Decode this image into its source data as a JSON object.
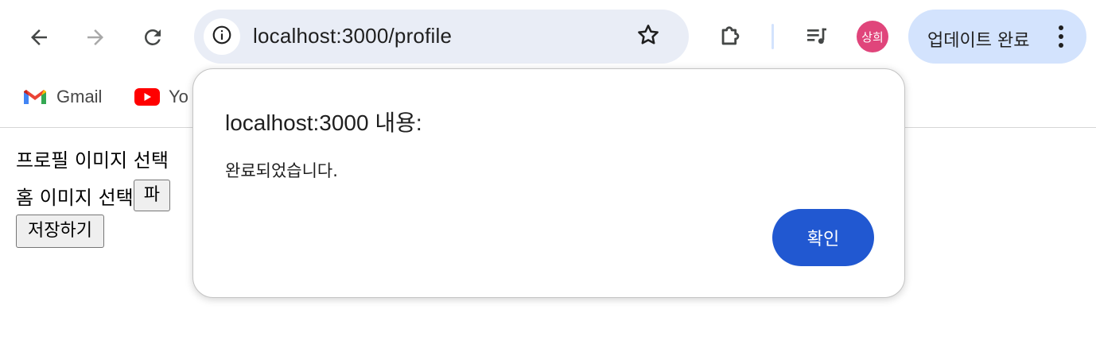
{
  "browser": {
    "url": "localhost:3000/profile",
    "profile_initials": "상희",
    "update_label": "업데이트 완료",
    "icons": {
      "back": "back-arrow-icon",
      "forward": "forward-arrow-icon",
      "reload": "reload-icon",
      "site_info": "info-icon",
      "bookmark_star": "star-icon",
      "extensions": "puzzle-icon",
      "media": "media-playlist-icon",
      "menu": "vertical-dots-icon"
    }
  },
  "bookmarks": [
    {
      "label": "Gmail",
      "icon": "gmail-icon"
    },
    {
      "label": "Yo",
      "icon": "youtube-icon"
    }
  ],
  "page": {
    "profile_image_label": "프로필 이미지 선택",
    "home_image_label": "홈 이미지 선택",
    "file_button_label": "파",
    "save_button_label": "저장하기"
  },
  "dialog": {
    "title": "localhost:3000 내용:",
    "message": "완료되었습니다.",
    "ok_label": "확인"
  },
  "colors": {
    "omnibox_bg": "#e9edf6",
    "update_pill_bg": "#d3e3fd",
    "avatar_bg": "#e0457b",
    "ok_button_bg": "#2158d1"
  }
}
